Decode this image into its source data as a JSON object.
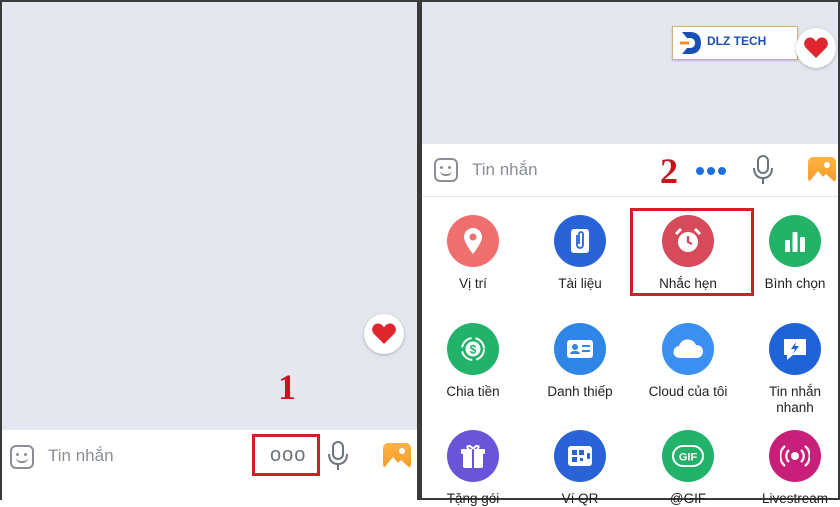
{
  "input": {
    "placeholder": "Tin nhắn"
  },
  "steps": {
    "one": "1",
    "two": "2"
  },
  "more_button": {
    "icon": "ellipsis-icon",
    "glyph": "ooo"
  },
  "logo": {
    "text": "DLZ TECH"
  },
  "features": [
    {
      "label": "Vị trí",
      "icon": "location-pin-icon",
      "color": "#ef6f6f"
    },
    {
      "label": "Tài liệu",
      "icon": "paperclip-document-icon",
      "color": "#2a63d8"
    },
    {
      "label": "Nhắc hẹn",
      "icon": "alarm-clock-icon",
      "color": "#d64a5c"
    },
    {
      "label": "Bình chọn",
      "icon": "bar-chart-icon",
      "color": "#22b268"
    },
    {
      "label": "Chia tiền",
      "icon": "dollar-split-icon",
      "color": "#23b26a"
    },
    {
      "label": "Danh thiếp",
      "icon": "contact-card-icon",
      "color": "#2f86e6"
    },
    {
      "label": "Cloud của tôi",
      "icon": "cloud-icon",
      "color": "#3a8ff0"
    },
    {
      "label": "Tin nhắn nhanh",
      "icon": "quick-message-icon",
      "color": "#1e63d8"
    },
    {
      "label": "Tặng gói",
      "icon": "gift-icon",
      "color": "#6a55d8"
    },
    {
      "label": "Ví QR",
      "icon": "qr-wallet-icon",
      "color": "#2a63d8"
    },
    {
      "label": "@GIF",
      "icon": "gif-icon",
      "color": "#23b26a"
    },
    {
      "label": "Livestream",
      "icon": "livestream-icon",
      "color": "#c8207a"
    }
  ],
  "colors": {
    "annotation_red": "#d21f26",
    "chat_bg": "#e4e8ee",
    "accent_blue": "#1f6fe0"
  }
}
